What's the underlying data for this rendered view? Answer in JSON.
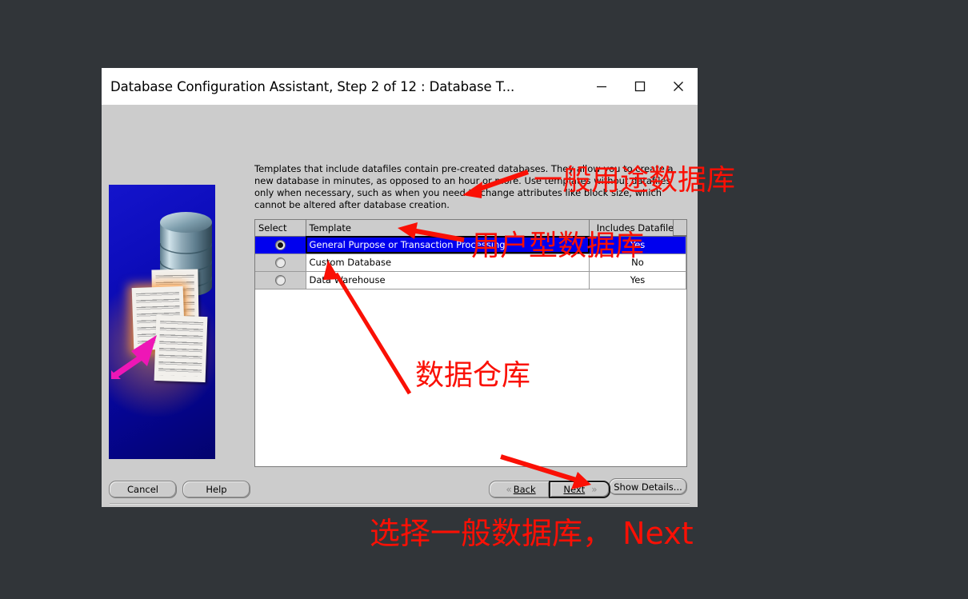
{
  "window": {
    "title": "Database Configuration Assistant, Step 2 of 12 : Database T...",
    "controls": {
      "minimize": "minimize-icon",
      "maximize": "maximize-icon",
      "close": "close-icon"
    }
  },
  "content": {
    "description": "Templates that include datafiles contain pre-created databases. They allow you to create a new database in minutes, as opposed to an hour or more. Use templates without datafiles only when necessary, such as when you need to change attributes like block size, which cannot be altered after database creation."
  },
  "table": {
    "headers": [
      "Select",
      "Template",
      "Includes Datafiles"
    ],
    "rows": [
      {
        "selected": true,
        "template": "General Purpose or Transaction Processing",
        "datafiles": "Yes"
      },
      {
        "selected": false,
        "template": "Custom Database",
        "datafiles": "No"
      },
      {
        "selected": false,
        "template": "Data Warehouse",
        "datafiles": "Yes"
      }
    ]
  },
  "buttons": {
    "show_details": "Show Details...",
    "cancel": "Cancel",
    "help": "Help",
    "back": "Back",
    "next": "Next",
    "back_chevron": "«",
    "next_chevron": "»"
  },
  "annotations": {
    "general_purpose": "一般用途数据库",
    "custom_database": "用户型数据库",
    "data_warehouse": "数据仓库",
    "bottom_note": "选择一般数据库， Next"
  },
  "colors": {
    "desktop_background": "#313539",
    "dialog_face": "#cccccc",
    "selection_blue": "#0000ee",
    "annotation_red": "#fa1005",
    "banner_blue": "#0d0dbb"
  }
}
